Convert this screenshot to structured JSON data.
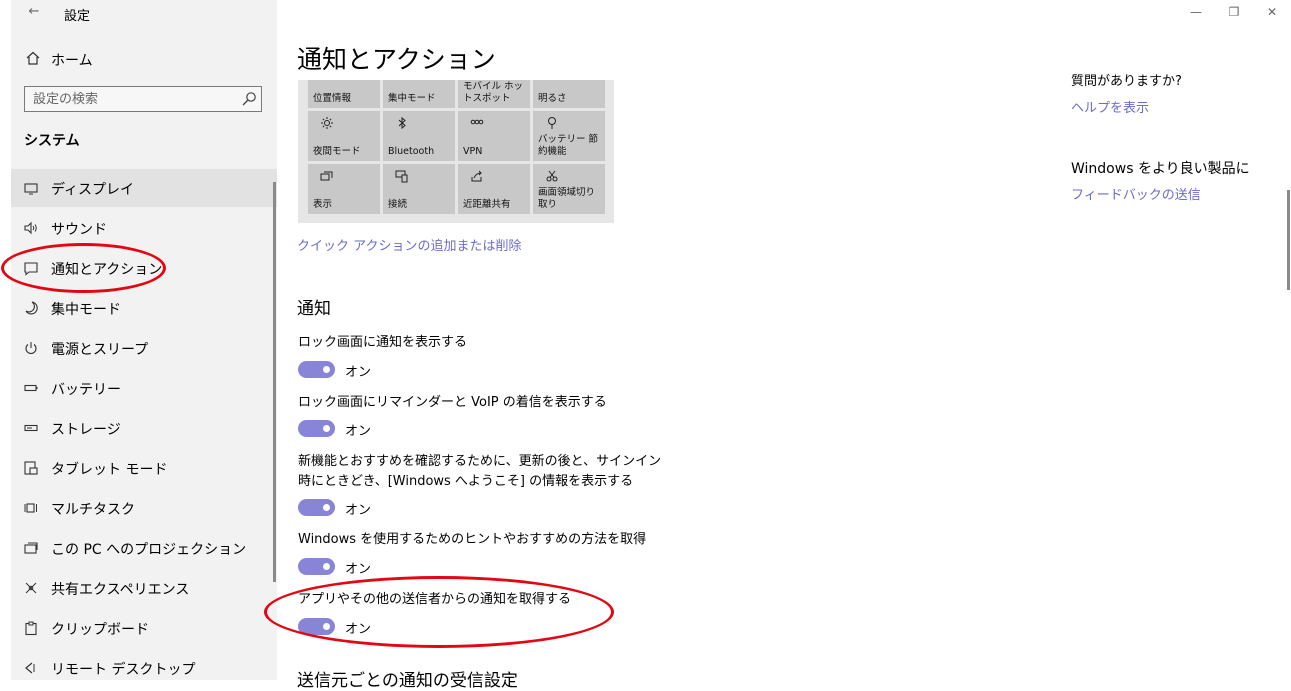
{
  "app": {
    "title": "設定",
    "back_glyph": "←"
  },
  "window_controls": {
    "minimize": "—",
    "restore": "❐",
    "close": "✕"
  },
  "sidebar": {
    "home_label": "ホーム",
    "search_placeholder": "設定の検索",
    "section_title": "システム",
    "items": [
      {
        "label": "ディスプレイ",
        "icon": "display-icon"
      },
      {
        "label": "サウンド",
        "icon": "speaker-icon"
      },
      {
        "label": "通知とアクション",
        "icon": "notification-icon"
      },
      {
        "label": "集中モード",
        "icon": "moon-icon"
      },
      {
        "label": "電源とスリープ",
        "icon": "power-icon"
      },
      {
        "label": "バッテリー",
        "icon": "battery-icon"
      },
      {
        "label": "ストレージ",
        "icon": "storage-icon"
      },
      {
        "label": "タブレット モード",
        "icon": "tablet-icon"
      },
      {
        "label": "マルチタスク",
        "icon": "multitask-icon"
      },
      {
        "label": "この PC へのプロジェクション",
        "icon": "projection-icon"
      },
      {
        "label": "共有エクスペリエンス",
        "icon": "shared-icon"
      },
      {
        "label": "クリップボード",
        "icon": "clipboard-icon"
      },
      {
        "label": "リモート デスクトップ",
        "icon": "remote-desktop-icon"
      }
    ]
  },
  "main": {
    "page_title": "通知とアクション",
    "quick_actions": {
      "tiles": [
        {
          "label": "位置情報",
          "icon": ""
        },
        {
          "label": "集中モード",
          "icon": ""
        },
        {
          "label": "モバイル ホットスポット",
          "icon": ""
        },
        {
          "label": "明るさ",
          "icon": ""
        },
        {
          "label": "夜間モード",
          "icon": "brightness-icon"
        },
        {
          "label": "Bluetooth",
          "icon": "bluetooth-icon"
        },
        {
          "label": "VPN",
          "icon": "vpn-icon"
        },
        {
          "label": "バッテリー 節約機能",
          "icon": "battery-saver-icon"
        },
        {
          "label": "表示",
          "icon": "project-icon"
        },
        {
          "label": "接続",
          "icon": "connect-icon"
        },
        {
          "label": "近距離共有",
          "icon": "nearby-share-icon"
        },
        {
          "label": "画面領域切り取り",
          "icon": "snip-icon"
        }
      ],
      "edit_link": "クイック アクションの追加または削除"
    },
    "notifications_heading": "通知",
    "settings": [
      {
        "label": "ロック画面に通知を表示する",
        "state": "オン"
      },
      {
        "label": "ロック画面にリマインダーと VoIP の着信を表示する",
        "state": "オン"
      },
      {
        "label": "新機能とおすすめを確認するために、更新の後と、サインイン時にときどき、[Windows へようこそ] の情報を表示する",
        "state": "オン"
      },
      {
        "label": "Windows を使用するためのヒントやおすすめの方法を取得",
        "state": "オン"
      },
      {
        "label": "アプリやその他の送信者からの通知を取得する",
        "state": "オン"
      }
    ],
    "sub_heading": "送信元ごとの通知の受信設定"
  },
  "right_panel": {
    "help_question": "質問がありますか?",
    "help_link": "ヘルプを表示",
    "feedback_heading": "Windows をより良い製品に",
    "feedback_link": "フィードバックの送信"
  },
  "colors": {
    "accent": "#8884d8",
    "link": "#6b6bce",
    "annotation": "#e30613"
  }
}
